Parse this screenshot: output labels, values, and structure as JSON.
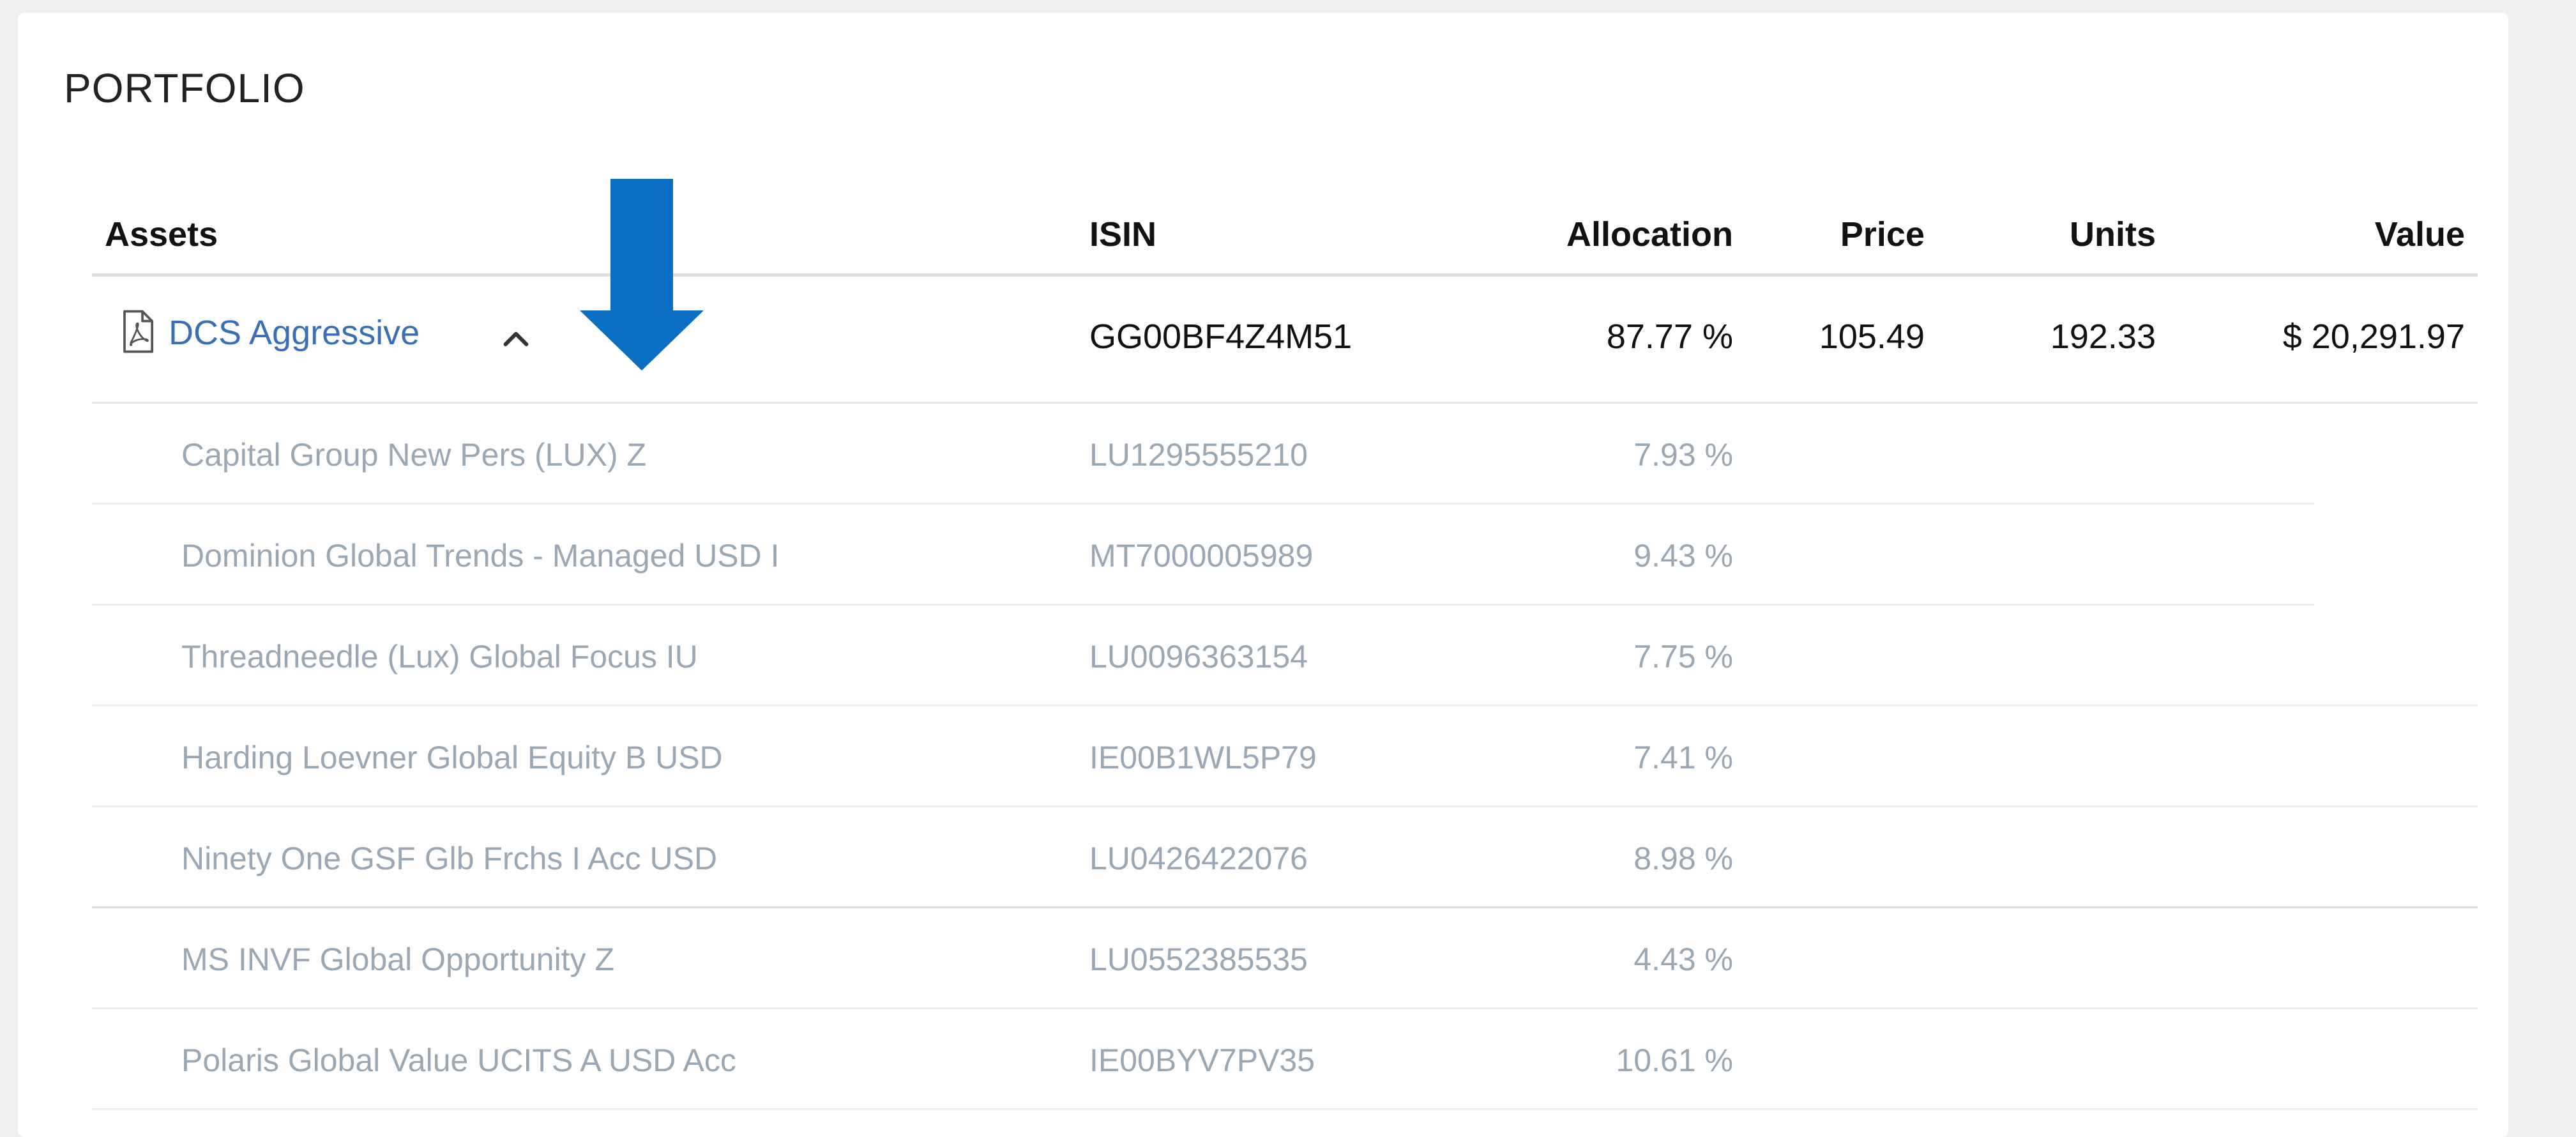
{
  "portfolio": {
    "title": "PORTFOLIO",
    "headers": {
      "assets": "Assets",
      "isin": "ISIN",
      "allocation": "Allocation",
      "price": "Price",
      "units": "Units",
      "value": "Value"
    },
    "parent": {
      "name": "DCS Aggressive",
      "isin": "GG00BF4Z4M51",
      "allocation": "87.77 %",
      "price": "105.49",
      "units": "192.33",
      "value": "$ 20,291.97",
      "icon": "pdf-icon",
      "expand_icon": "chevron-up-icon",
      "expanded": true
    },
    "children": [
      {
        "name": "Capital Group New Pers (LUX) Z",
        "isin": "LU1295555210",
        "allocation": "7.93 %"
      },
      {
        "name": "Dominion Global Trends - Managed USD I",
        "isin": "MT7000005989",
        "allocation": "9.43 %"
      },
      {
        "name": "Threadneedle (Lux) Global Focus IU",
        "isin": "LU0096363154",
        "allocation": "7.75 %"
      },
      {
        "name": "Harding Loevner Global Equity B USD",
        "isin": "IE00B1WL5P79",
        "allocation": "7.41 %"
      },
      {
        "name": "Ninety One GSF Glb Frchs I Acc USD",
        "isin": "LU0426422076",
        "allocation": "8.98 %"
      },
      {
        "name": "MS INVF Global Opportunity Z",
        "isin": "LU0552385535",
        "allocation": "4.43 %"
      },
      {
        "name": "Polaris Global Value UCITS A USD Acc",
        "isin": "IE00BYV7PV35",
        "allocation": "10.61 %"
      }
    ]
  },
  "annotation": {
    "arrow_color": "#0a6fc2",
    "icon": "down-arrow-icon"
  },
  "colors": {
    "link": "#3a6fb5",
    "child_text": "#9aa7b5",
    "header_text": "#111111"
  }
}
